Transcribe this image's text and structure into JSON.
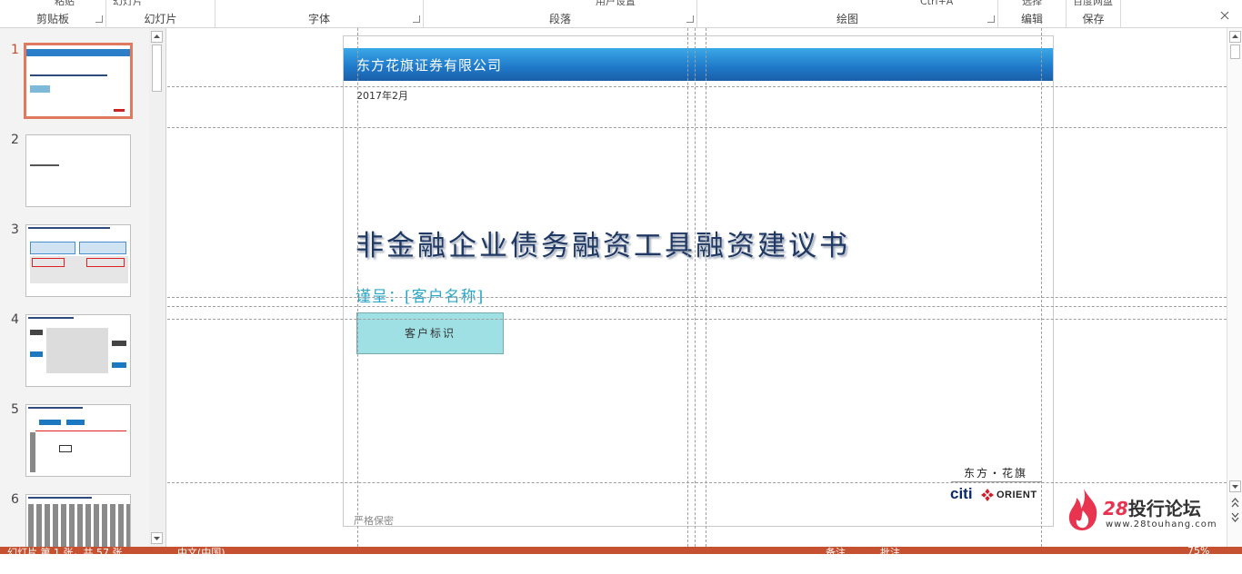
{
  "ribbon": {
    "cutoff_texts": [
      "粘贴",
      "幻灯片",
      "用户设置",
      "Ctrl+A",
      "选择",
      "百度网盘"
    ],
    "groups": [
      {
        "label": "剪贴板"
      },
      {
        "label": "幻灯片"
      },
      {
        "label": "字体"
      },
      {
        "label": "段落"
      },
      {
        "label": "绘图"
      },
      {
        "label": "编辑"
      },
      {
        "label": "保存"
      }
    ]
  },
  "thumbnails": [
    {
      "number": "1"
    },
    {
      "number": "2"
    },
    {
      "number": "3"
    },
    {
      "number": "4"
    },
    {
      "number": "5"
    },
    {
      "number": "6"
    }
  ],
  "slide": {
    "header": "东方花旗证券有限公司",
    "date": "2017年2月",
    "title": "非金融企业债务融资工具融资建议书",
    "subtitle": "谨呈：[客户名称]",
    "client_box": "客户标识",
    "logo_cn": "东方・花旗",
    "logo_citi": "citi",
    "logo_orient": "ORIENT",
    "confidential": "严格保密"
  },
  "watermark": {
    "number": "28",
    "name": "投行论坛",
    "url": "www.28touhang.com"
  },
  "status": {
    "slide_info": "幻灯片 第 1 张，共 57 张",
    "language": "中文(中国)",
    "notes": "备注",
    "comments": "批注",
    "zoom": "75%"
  },
  "colors": {
    "accent_orange": "#c65131",
    "banner_blue": "#1f78c8",
    "title_navy": "#1f3864",
    "subtitle_cyan": "#2aa7c8",
    "client_box_fill": "#9ee0e4"
  }
}
